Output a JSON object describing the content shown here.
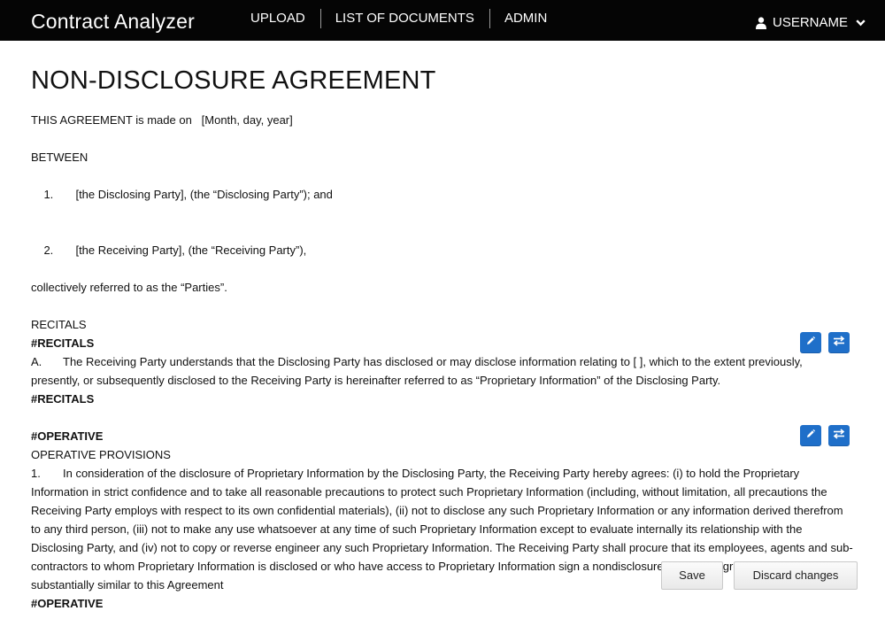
{
  "app": {
    "title": "Contract Analyzer"
  },
  "nav": {
    "items": [
      {
        "label": "UPLOAD"
      },
      {
        "label": "LIST OF DOCUMENTS"
      },
      {
        "label": "ADMIN"
      }
    ],
    "user": {
      "label": "USERNAME",
      "icon": "user-icon",
      "dropdown_icon": "chevron-down-icon"
    }
  },
  "document": {
    "title": "NON-DISCLOSURE AGREEMENT",
    "intro": "THIS AGREEMENT is made on   [Month, day, year]",
    "between_heading": "BETWEEN",
    "parties": [
      {
        "num": "1.",
        "text": "[the Disclosing Party], (the “Disclosing Party”); and"
      },
      {
        "num": "2.",
        "text": "[the Receiving Party], (the “Receiving Party”),"
      }
    ],
    "parties_note": "collectively referred to as the “Parties”.",
    "recitals": {
      "heading": "RECITALS",
      "tag_open": "#RECITALS",
      "num": "A.",
      "text": "The Receiving Party understands that the Disclosing Party has disclosed or may disclose information relating to [ ], which to the extent previously, presently, or subsequently disclosed to the Receiving Party is hereinafter referred to as “Proprietary Information” of the Disclosing Party.",
      "tag_close": "#RECITALS"
    },
    "operative": {
      "tag_open": "#OPERATIVE",
      "heading": "OPERATIVE PROVISIONS",
      "num": "1.",
      "text": "In consideration of the disclosure of Proprietary Information by the Disclosing Party, the Receiving Party hereby agrees: (i) to hold the Proprietary Information in strict confidence and to take all reasonable precautions to protect such Proprietary Information (including, without limitation, all precautions the Receiving Party employs with respect to its own confidential materials), (ii) not to disclose any such Proprietary Information or any information derived therefrom to any third person, (iii) not to make any use whatsoever at any time of such Proprietary Information except to evaluate internally its relationship with the Disclosing Party, and (iv) not to copy or reverse engineer any such Proprietary Information. The Receiving Party shall procure that its employees, agents and sub-contractors to whom Proprietary Information is disclosed or who have access to Proprietary Information sign a nondisclosure or similar agreement in content substantially similar to this Agreement",
      "tag_close": "#OPERATIVE"
    }
  },
  "section_actions": {
    "edit_icon": "pencil-icon",
    "swap_icon": "swap-arrows-icon",
    "color": "#1f6fc9"
  },
  "footer": {
    "save_label": "Save",
    "discard_label": "Discard changes"
  }
}
